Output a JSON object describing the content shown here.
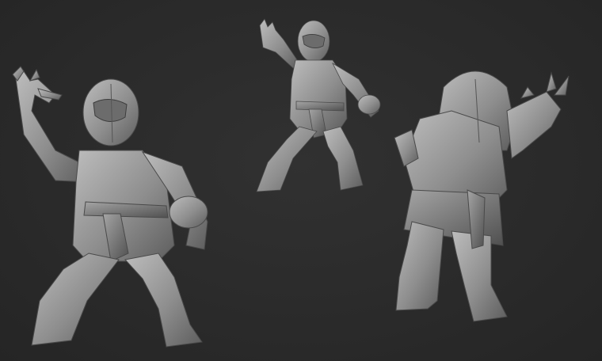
{
  "scene": {
    "background_color": "#2b2b2b",
    "material_color": "#9a9a9a",
    "views": [
      {
        "name": "front-left-view"
      },
      {
        "name": "front-small-view"
      },
      {
        "name": "back-right-view"
      }
    ]
  }
}
